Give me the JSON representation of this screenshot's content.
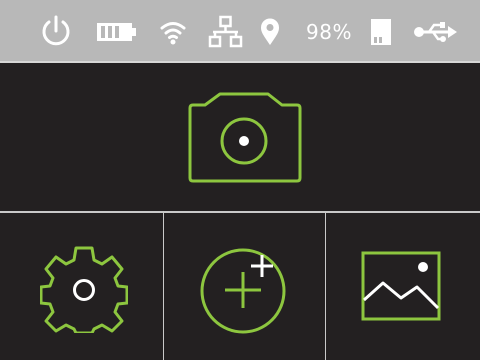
{
  "status_bar": {
    "icons": [
      "power-icon",
      "battery-icon",
      "wifi-icon",
      "network-icon",
      "location-icon",
      "sd-card-icon",
      "usb-icon"
    ],
    "battery_level": "98%"
  },
  "main": {
    "camera": {
      "icon": "camera-icon"
    },
    "tiles": [
      {
        "icon": "gear-icon"
      },
      {
        "icon": "add-circle-icon"
      },
      {
        "icon": "gallery-icon"
      }
    ]
  },
  "colors": {
    "accent": "#8dc63f",
    "status_bar_bg": "#b8b8b8",
    "background": "#222021",
    "divider": "#c9c9c9",
    "status_icon": "#ffffff"
  }
}
